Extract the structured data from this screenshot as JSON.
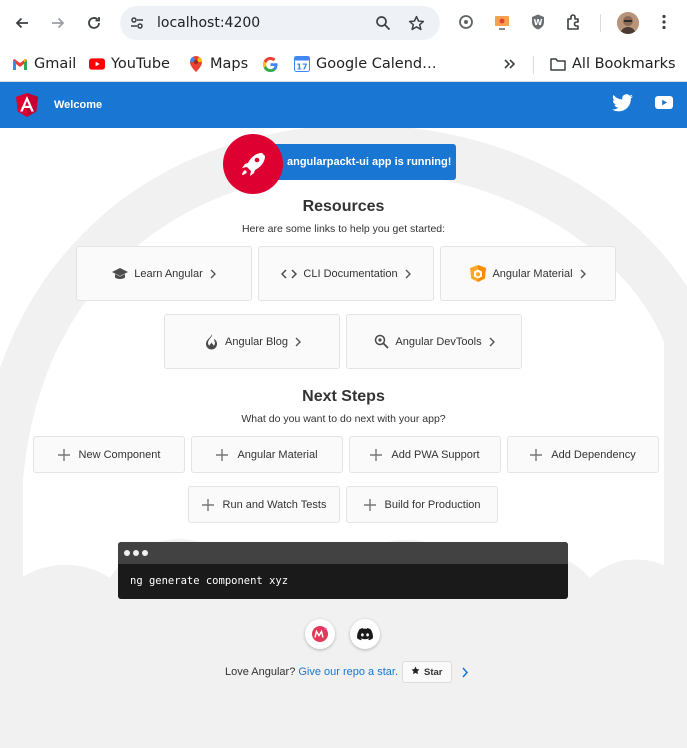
{
  "browser": {
    "url": "localhost:4200",
    "bookmarks": [
      {
        "label": "Gmail",
        "icon": "gmail-icon"
      },
      {
        "label": "YouTube",
        "icon": "youtube-icon"
      },
      {
        "label": "Maps",
        "icon": "maps-icon"
      },
      {
        "label": "",
        "icon": "google-icon"
      },
      {
        "label": "Google Calend…",
        "icon": "calendar-icon"
      }
    ],
    "all_bookmarks": "All Bookmarks",
    "calendar_day": "17"
  },
  "toolbar": {
    "title": "Welcome",
    "logo_letter": "A",
    "accent": "#1976d2",
    "brand_red": "#dd0031"
  },
  "banner": {
    "text": "angularpackt-ui app is running!"
  },
  "resources": {
    "title": "Resources",
    "subtitle": "Here are some links to help you get started:",
    "links": [
      {
        "label": "Learn Angular",
        "icon": "graduation-cap-icon"
      },
      {
        "label": "CLI Documentation",
        "icon": "code-brackets-icon"
      },
      {
        "label": "Angular Material",
        "icon": "material-shield-icon"
      },
      {
        "label": "Angular Blog",
        "icon": "flame-icon"
      },
      {
        "label": "Angular DevTools",
        "icon": "devtools-search-icon"
      }
    ]
  },
  "next_steps": {
    "title": "Next Steps",
    "subtitle": "What do you want to do next with your app?",
    "items": [
      {
        "label": "New Component"
      },
      {
        "label": "Angular Material"
      },
      {
        "label": "Add PWA Support"
      },
      {
        "label": "Add Dependency"
      },
      {
        "label": "Run and Watch Tests"
      },
      {
        "label": "Build for Production"
      }
    ]
  },
  "terminal": {
    "command": "ng generate component xyz"
  },
  "footer": {
    "text": "Love Angular?",
    "link": "Give our repo a star.",
    "star_label": "Star"
  }
}
